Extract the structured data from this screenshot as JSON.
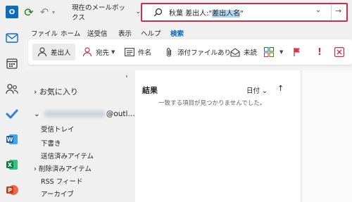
{
  "titlebar": {
    "app_logo_letter": "O",
    "scope_label": "現在のメールボックス",
    "search": {
      "prefix": "秋葉 差出人:\"",
      "highlighted": "差出人名",
      "suffix": "\""
    }
  },
  "tabs": [
    "ファイル",
    "ホーム",
    "送受信",
    "表示",
    "ヘルプ",
    "検索"
  ],
  "active_tab": "検索",
  "ribbon": {
    "from_label": "差出人",
    "to_label": "宛先",
    "subject_label": "件名",
    "attachments_label": "添付ファイルあり",
    "unread_label": "未読"
  },
  "folderpane": {
    "favorites_label": "お気に入り",
    "account_suffix": "@outl…",
    "folders": [
      "受信トレイ",
      "下書き",
      "送信済みアイテム",
      "削除済みアイテム",
      "RSS フィード",
      "アーカイブ"
    ]
  },
  "message_list": {
    "title": "結果",
    "sort_label": "日付",
    "empty_text": "一致する項目が見つかりませんでした。"
  },
  "colors": {
    "accent": "#0f6cbd",
    "search_border": "#c4314b",
    "highlight": "#b4d6f5",
    "sync_green": "#107c10"
  }
}
